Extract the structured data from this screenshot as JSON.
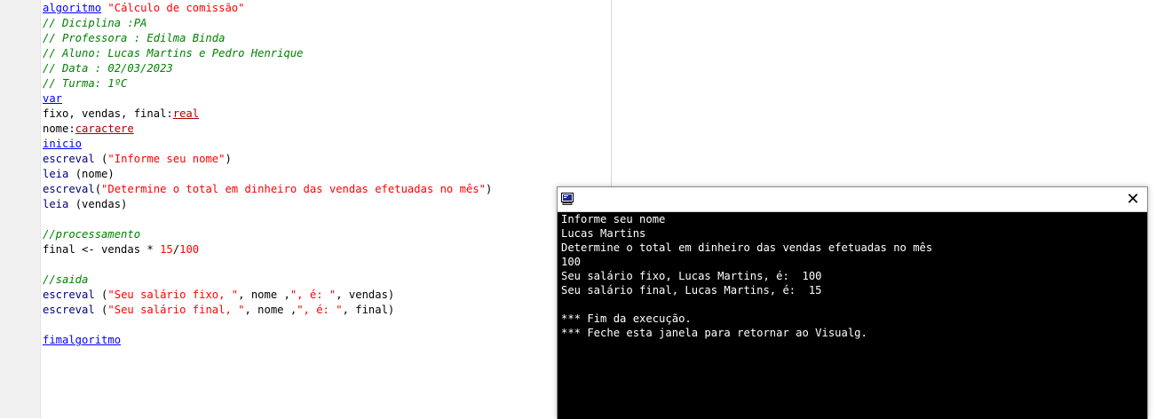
{
  "editor": {
    "lines": [
      [
        {
          "t": "algoritmo",
          "c": "kw"
        },
        {
          "t": " "
        },
        {
          "t": "\"Cálculo de comissão\"",
          "c": "str"
        }
      ],
      [
        {
          "t": "// Diciplina :PA",
          "c": "cmt"
        }
      ],
      [
        {
          "t": "// Professora : Edilma Binda",
          "c": "cmt"
        }
      ],
      [
        {
          "t": "// Aluno: Lucas Martins e Pedro Henrique",
          "c": "cmt"
        }
      ],
      [
        {
          "t": "// Data : 02/03/2023",
          "c": "cmt"
        }
      ],
      [
        {
          "t": "// Turma: 1ºC",
          "c": "cmt"
        }
      ],
      [
        {
          "t": "var",
          "c": "kw"
        }
      ],
      [
        {
          "t": "fixo, vendas, final:"
        },
        {
          "t": "real",
          "c": "type"
        }
      ],
      [
        {
          "t": "nome:"
        },
        {
          "t": "caractere",
          "c": "type"
        }
      ],
      [
        {
          "t": "inicio",
          "c": "kw"
        }
      ],
      [
        {
          "t": "escreval",
          "c": "fn"
        },
        {
          "t": " ("
        },
        {
          "t": "\"Informe seu nome\"",
          "c": "str"
        },
        {
          "t": ")"
        }
      ],
      [
        {
          "t": "leia",
          "c": "fn"
        },
        {
          "t": " (nome)"
        }
      ],
      [
        {
          "t": "escreval",
          "c": "fn"
        },
        {
          "t": "("
        },
        {
          "t": "\"Determine o total em dinheiro das vendas efetuadas no mês\"",
          "c": "str"
        },
        {
          "t": ")"
        }
      ],
      [
        {
          "t": "leia",
          "c": "fn"
        },
        {
          "t": " (vendas)"
        }
      ],
      [],
      [
        {
          "t": "//processamento",
          "c": "cmt"
        }
      ],
      [
        {
          "t": "final <- vendas * "
        },
        {
          "t": "15",
          "c": "num"
        },
        {
          "t": "/"
        },
        {
          "t": "100",
          "c": "num"
        }
      ],
      [],
      [
        {
          "t": "//saida",
          "c": "cmt"
        }
      ],
      [
        {
          "t": "escreval",
          "c": "fn"
        },
        {
          "t": " ("
        },
        {
          "t": "\"Seu salário fixo, \"",
          "c": "str"
        },
        {
          "t": ", nome ,"
        },
        {
          "t": "\", é: \"",
          "c": "str"
        },
        {
          "t": ", vendas)"
        }
      ],
      [
        {
          "t": "escreval",
          "c": "fn"
        },
        {
          "t": " ("
        },
        {
          "t": "\"Seu salário final, \"",
          "c": "str"
        },
        {
          "t": ", nome ,"
        },
        {
          "t": "\", é: \"",
          "c": "str"
        },
        {
          "t": ", final)"
        }
      ],
      [],
      [
        {
          "t": "fimalgoritmo",
          "c": "kw"
        }
      ]
    ]
  },
  "console": {
    "close_glyph": "✕",
    "output": [
      "Informe seu nome",
      "Lucas Martins",
      "Determine o total em dinheiro das vendas efetuadas no mês",
      "100",
      "Seu salário fixo, Lucas Martins, é:  100",
      "Seu salário final, Lucas Martins, é:  15",
      "",
      "*** Fim da execução.",
      "*** Feche esta janela para retornar ao Visualg."
    ]
  },
  "colors": {
    "keyword": "#0000ff",
    "string": "#ff0000",
    "comment": "#008000",
    "type": "#b00000",
    "console_bg": "#000000",
    "console_fg": "#ffffff"
  },
  "icons": {
    "console_app": "terminal-window-icon",
    "close": "close-icon"
  }
}
